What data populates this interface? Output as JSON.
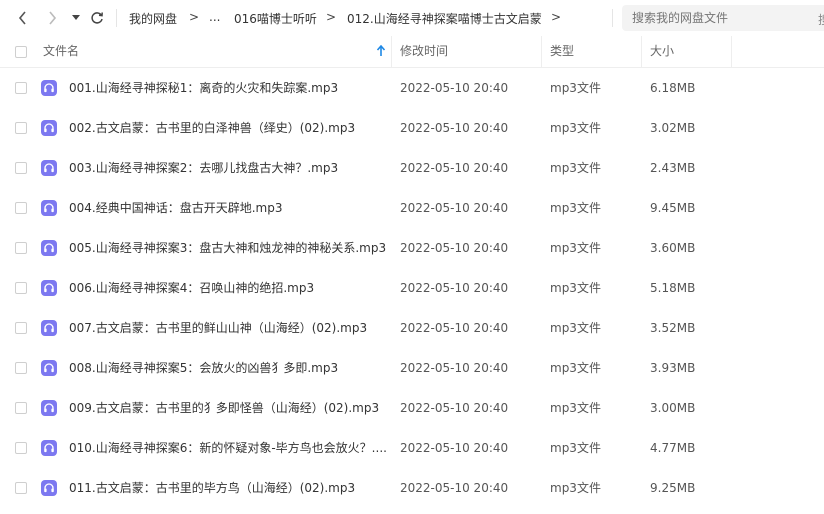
{
  "nav": {
    "breadcrumb": [
      "我的网盘",
      "...",
      "016喵博士听听",
      "012.山海经寻神探案喵博士古文启蒙"
    ],
    "separator": ">"
  },
  "search": {
    "placeholder": "搜索我的网盘文件",
    "button_label": "搜"
  },
  "columns": {
    "name": "文件名",
    "modified": "修改时间",
    "type": "类型",
    "size": "大小"
  },
  "files": [
    {
      "name": "001.山海经寻神探秘1：离奇的火灾和失踪案.mp3",
      "modified": "2022-05-10 20:40",
      "type": "mp3文件",
      "size": "6.18MB"
    },
    {
      "name": "002.古文启蒙：古书里的白泽神兽（绎史）(02).mp3",
      "modified": "2022-05-10 20:40",
      "type": "mp3文件",
      "size": "3.02MB"
    },
    {
      "name": "003.山海经寻神探案2：去哪儿找盘古大神？.mp3",
      "modified": "2022-05-10 20:40",
      "type": "mp3文件",
      "size": "2.43MB"
    },
    {
      "name": "004.经典中国神话：盘古开天辟地.mp3",
      "modified": "2022-05-10 20:40",
      "type": "mp3文件",
      "size": "9.45MB"
    },
    {
      "name": "005.山海经寻神探案3：盘古大神和烛龙神的神秘关系.mp3",
      "modified": "2022-05-10 20:40",
      "type": "mp3文件",
      "size": "3.60MB"
    },
    {
      "name": "006.山海经寻神探案4：召唤山神的绝招.mp3",
      "modified": "2022-05-10 20:40",
      "type": "mp3文件",
      "size": "5.18MB"
    },
    {
      "name": "007.古文启蒙：古书里的鲜山山神（山海经）(02).mp3",
      "modified": "2022-05-10 20:40",
      "type": "mp3文件",
      "size": "3.52MB"
    },
    {
      "name": "008.山海经寻神探案5：会放火的凶兽犭多即.mp3",
      "modified": "2022-05-10 20:40",
      "type": "mp3文件",
      "size": "3.93MB"
    },
    {
      "name": "009.古文启蒙：古书里的犭多即怪兽（山海经）(02).mp3",
      "modified": "2022-05-10 20:40",
      "type": "mp3文件",
      "size": "3.00MB"
    },
    {
      "name": "010.山海经寻神探案6：新的怀疑对象-毕方鸟也会放火？....",
      "modified": "2022-05-10 20:40",
      "type": "mp3文件",
      "size": "4.77MB"
    },
    {
      "name": "011.古文启蒙：古书里的毕方鸟（山海经）(02).mp3",
      "modified": "2022-05-10 20:40",
      "type": "mp3文件",
      "size": "9.25MB"
    }
  ],
  "colors": {
    "file_icon": "#7c78f0",
    "accent": "#1e88e5"
  },
  "icons": {
    "file": "headphones-icon"
  }
}
